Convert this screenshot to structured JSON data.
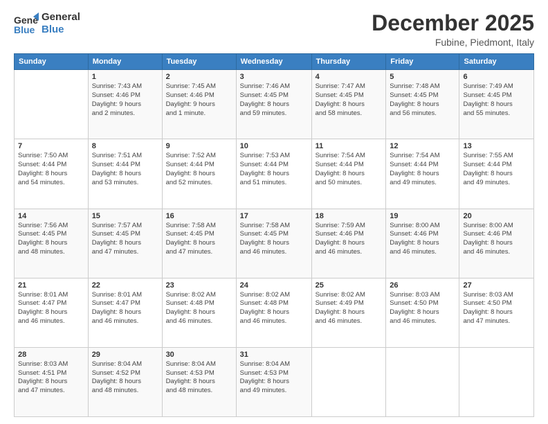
{
  "logo": {
    "line1": "General",
    "line2": "Blue"
  },
  "title": "December 2025",
  "location": "Fubine, Piedmont, Italy",
  "days_of_week": [
    "Sunday",
    "Monday",
    "Tuesday",
    "Wednesday",
    "Thursday",
    "Friday",
    "Saturday"
  ],
  "weeks": [
    [
      {
        "day": "",
        "info": ""
      },
      {
        "day": "1",
        "info": "Sunrise: 7:43 AM\nSunset: 4:46 PM\nDaylight: 9 hours\nand 2 minutes."
      },
      {
        "day": "2",
        "info": "Sunrise: 7:45 AM\nSunset: 4:46 PM\nDaylight: 9 hours\nand 1 minute."
      },
      {
        "day": "3",
        "info": "Sunrise: 7:46 AM\nSunset: 4:45 PM\nDaylight: 8 hours\nand 59 minutes."
      },
      {
        "day": "4",
        "info": "Sunrise: 7:47 AM\nSunset: 4:45 PM\nDaylight: 8 hours\nand 58 minutes."
      },
      {
        "day": "5",
        "info": "Sunrise: 7:48 AM\nSunset: 4:45 PM\nDaylight: 8 hours\nand 56 minutes."
      },
      {
        "day": "6",
        "info": "Sunrise: 7:49 AM\nSunset: 4:45 PM\nDaylight: 8 hours\nand 55 minutes."
      }
    ],
    [
      {
        "day": "7",
        "info": "Sunrise: 7:50 AM\nSunset: 4:44 PM\nDaylight: 8 hours\nand 54 minutes."
      },
      {
        "day": "8",
        "info": "Sunrise: 7:51 AM\nSunset: 4:44 PM\nDaylight: 8 hours\nand 53 minutes."
      },
      {
        "day": "9",
        "info": "Sunrise: 7:52 AM\nSunset: 4:44 PM\nDaylight: 8 hours\nand 52 minutes."
      },
      {
        "day": "10",
        "info": "Sunrise: 7:53 AM\nSunset: 4:44 PM\nDaylight: 8 hours\nand 51 minutes."
      },
      {
        "day": "11",
        "info": "Sunrise: 7:54 AM\nSunset: 4:44 PM\nDaylight: 8 hours\nand 50 minutes."
      },
      {
        "day": "12",
        "info": "Sunrise: 7:54 AM\nSunset: 4:44 PM\nDaylight: 8 hours\nand 49 minutes."
      },
      {
        "day": "13",
        "info": "Sunrise: 7:55 AM\nSunset: 4:44 PM\nDaylight: 8 hours\nand 49 minutes."
      }
    ],
    [
      {
        "day": "14",
        "info": "Sunrise: 7:56 AM\nSunset: 4:45 PM\nDaylight: 8 hours\nand 48 minutes."
      },
      {
        "day": "15",
        "info": "Sunrise: 7:57 AM\nSunset: 4:45 PM\nDaylight: 8 hours\nand 47 minutes."
      },
      {
        "day": "16",
        "info": "Sunrise: 7:58 AM\nSunset: 4:45 PM\nDaylight: 8 hours\nand 47 minutes."
      },
      {
        "day": "17",
        "info": "Sunrise: 7:58 AM\nSunset: 4:45 PM\nDaylight: 8 hours\nand 46 minutes."
      },
      {
        "day": "18",
        "info": "Sunrise: 7:59 AM\nSunset: 4:46 PM\nDaylight: 8 hours\nand 46 minutes."
      },
      {
        "day": "19",
        "info": "Sunrise: 8:00 AM\nSunset: 4:46 PM\nDaylight: 8 hours\nand 46 minutes."
      },
      {
        "day": "20",
        "info": "Sunrise: 8:00 AM\nSunset: 4:46 PM\nDaylight: 8 hours\nand 46 minutes."
      }
    ],
    [
      {
        "day": "21",
        "info": "Sunrise: 8:01 AM\nSunset: 4:47 PM\nDaylight: 8 hours\nand 46 minutes."
      },
      {
        "day": "22",
        "info": "Sunrise: 8:01 AM\nSunset: 4:47 PM\nDaylight: 8 hours\nand 46 minutes."
      },
      {
        "day": "23",
        "info": "Sunrise: 8:02 AM\nSunset: 4:48 PM\nDaylight: 8 hours\nand 46 minutes."
      },
      {
        "day": "24",
        "info": "Sunrise: 8:02 AM\nSunset: 4:48 PM\nDaylight: 8 hours\nand 46 minutes."
      },
      {
        "day": "25",
        "info": "Sunrise: 8:02 AM\nSunset: 4:49 PM\nDaylight: 8 hours\nand 46 minutes."
      },
      {
        "day": "26",
        "info": "Sunrise: 8:03 AM\nSunset: 4:50 PM\nDaylight: 8 hours\nand 46 minutes."
      },
      {
        "day": "27",
        "info": "Sunrise: 8:03 AM\nSunset: 4:50 PM\nDaylight: 8 hours\nand 47 minutes."
      }
    ],
    [
      {
        "day": "28",
        "info": "Sunrise: 8:03 AM\nSunset: 4:51 PM\nDaylight: 8 hours\nand 47 minutes."
      },
      {
        "day": "29",
        "info": "Sunrise: 8:04 AM\nSunset: 4:52 PM\nDaylight: 8 hours\nand 48 minutes."
      },
      {
        "day": "30",
        "info": "Sunrise: 8:04 AM\nSunset: 4:53 PM\nDaylight: 8 hours\nand 48 minutes."
      },
      {
        "day": "31",
        "info": "Sunrise: 8:04 AM\nSunset: 4:53 PM\nDaylight: 8 hours\nand 49 minutes."
      },
      {
        "day": "",
        "info": ""
      },
      {
        "day": "",
        "info": ""
      },
      {
        "day": "",
        "info": ""
      }
    ]
  ]
}
